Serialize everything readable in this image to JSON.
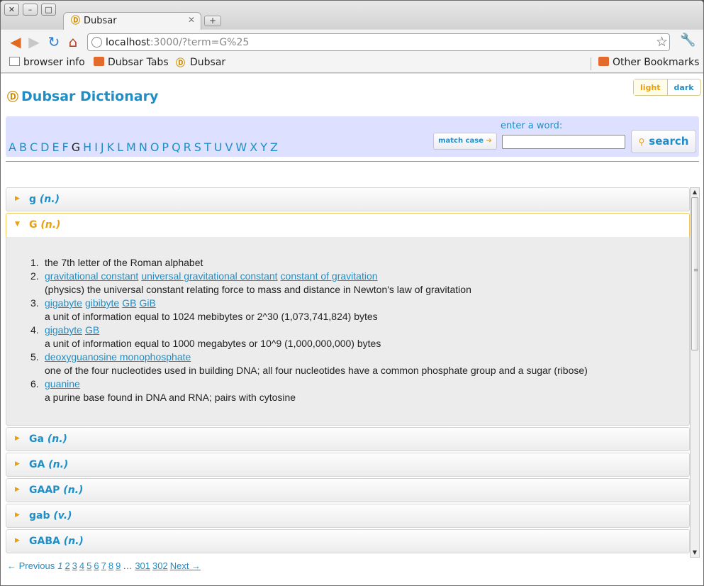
{
  "browser": {
    "tab_title": "Dubsar",
    "url_host": "localhost",
    "url_rest": ":3000/?term=G%25",
    "bookmarks": [
      "browser info",
      "Dubsar Tabs",
      "Dubsar"
    ],
    "other_bookmarks": "Other Bookmarks"
  },
  "header": {
    "site_title": "Dubsar Dictionary",
    "theme_light": "light",
    "theme_dark": "dark"
  },
  "search": {
    "letters": [
      "A",
      "B",
      "C",
      "D",
      "E",
      "F",
      "G",
      "H",
      "I",
      "J",
      "K",
      "L",
      "M",
      "N",
      "O",
      "P",
      "Q",
      "R",
      "S",
      "T",
      "U",
      "V",
      "W",
      "X",
      "Y",
      "Z"
    ],
    "current_letter": "G",
    "enter_label": "enter a word:",
    "match_case_label": "match case",
    "search_label": "search",
    "input_value": ""
  },
  "entries": [
    {
      "word": "g",
      "pos": "(n.)"
    },
    {
      "word": "G",
      "pos": "(n.)",
      "open": true
    },
    {
      "word": "Ga",
      "pos": "(n.)"
    },
    {
      "word": "GA",
      "pos": "(n.)"
    },
    {
      "word": "GAAP",
      "pos": "(n.)"
    },
    {
      "word": "gab",
      "pos": "(v.)"
    },
    {
      "word": "GABA",
      "pos": "(n.)"
    }
  ],
  "senses": [
    {
      "num": "1.",
      "synonyms": [],
      "gloss": "the 7th letter of the Roman alphabet"
    },
    {
      "num": "2.",
      "synonyms": [
        "gravitational constant",
        "universal gravitational constant",
        "constant of gravitation"
      ],
      "gloss": "(physics) the universal constant relating force to mass and distance in Newton's law of gravitation"
    },
    {
      "num": "3.",
      "synonyms": [
        "gigabyte",
        "gibibyte",
        "GB",
        "GiB"
      ],
      "gloss": "a unit of information equal to 1024 mebibytes or 2^30 (1,073,741,824) bytes"
    },
    {
      "num": "4.",
      "synonyms": [
        "gigabyte",
        "GB"
      ],
      "gloss": "a unit of information equal to 1000 megabytes or 10^9 (1,000,000,000) bytes"
    },
    {
      "num": "5.",
      "synonyms": [
        "deoxyguanosine monophosphate"
      ],
      "gloss": "one of the four nucleotides used in building DNA; all four nucleotides have a common phosphate group and a sugar (ribose)"
    },
    {
      "num": "6.",
      "synonyms": [
        "guanine"
      ],
      "gloss": "a purine base found in DNA and RNA; pairs with cytosine"
    }
  ],
  "pagination": {
    "previous": "← Previous",
    "current": "1",
    "pages": [
      "2",
      "3",
      "4",
      "5",
      "6",
      "7",
      "8",
      "9"
    ],
    "gap": "…",
    "last_pages": [
      "301",
      "302"
    ],
    "next": "Next →"
  },
  "colors": {
    "accent": "#1f8ec7",
    "highlight": "#e8a010",
    "search_bg": "#dde0fe"
  }
}
